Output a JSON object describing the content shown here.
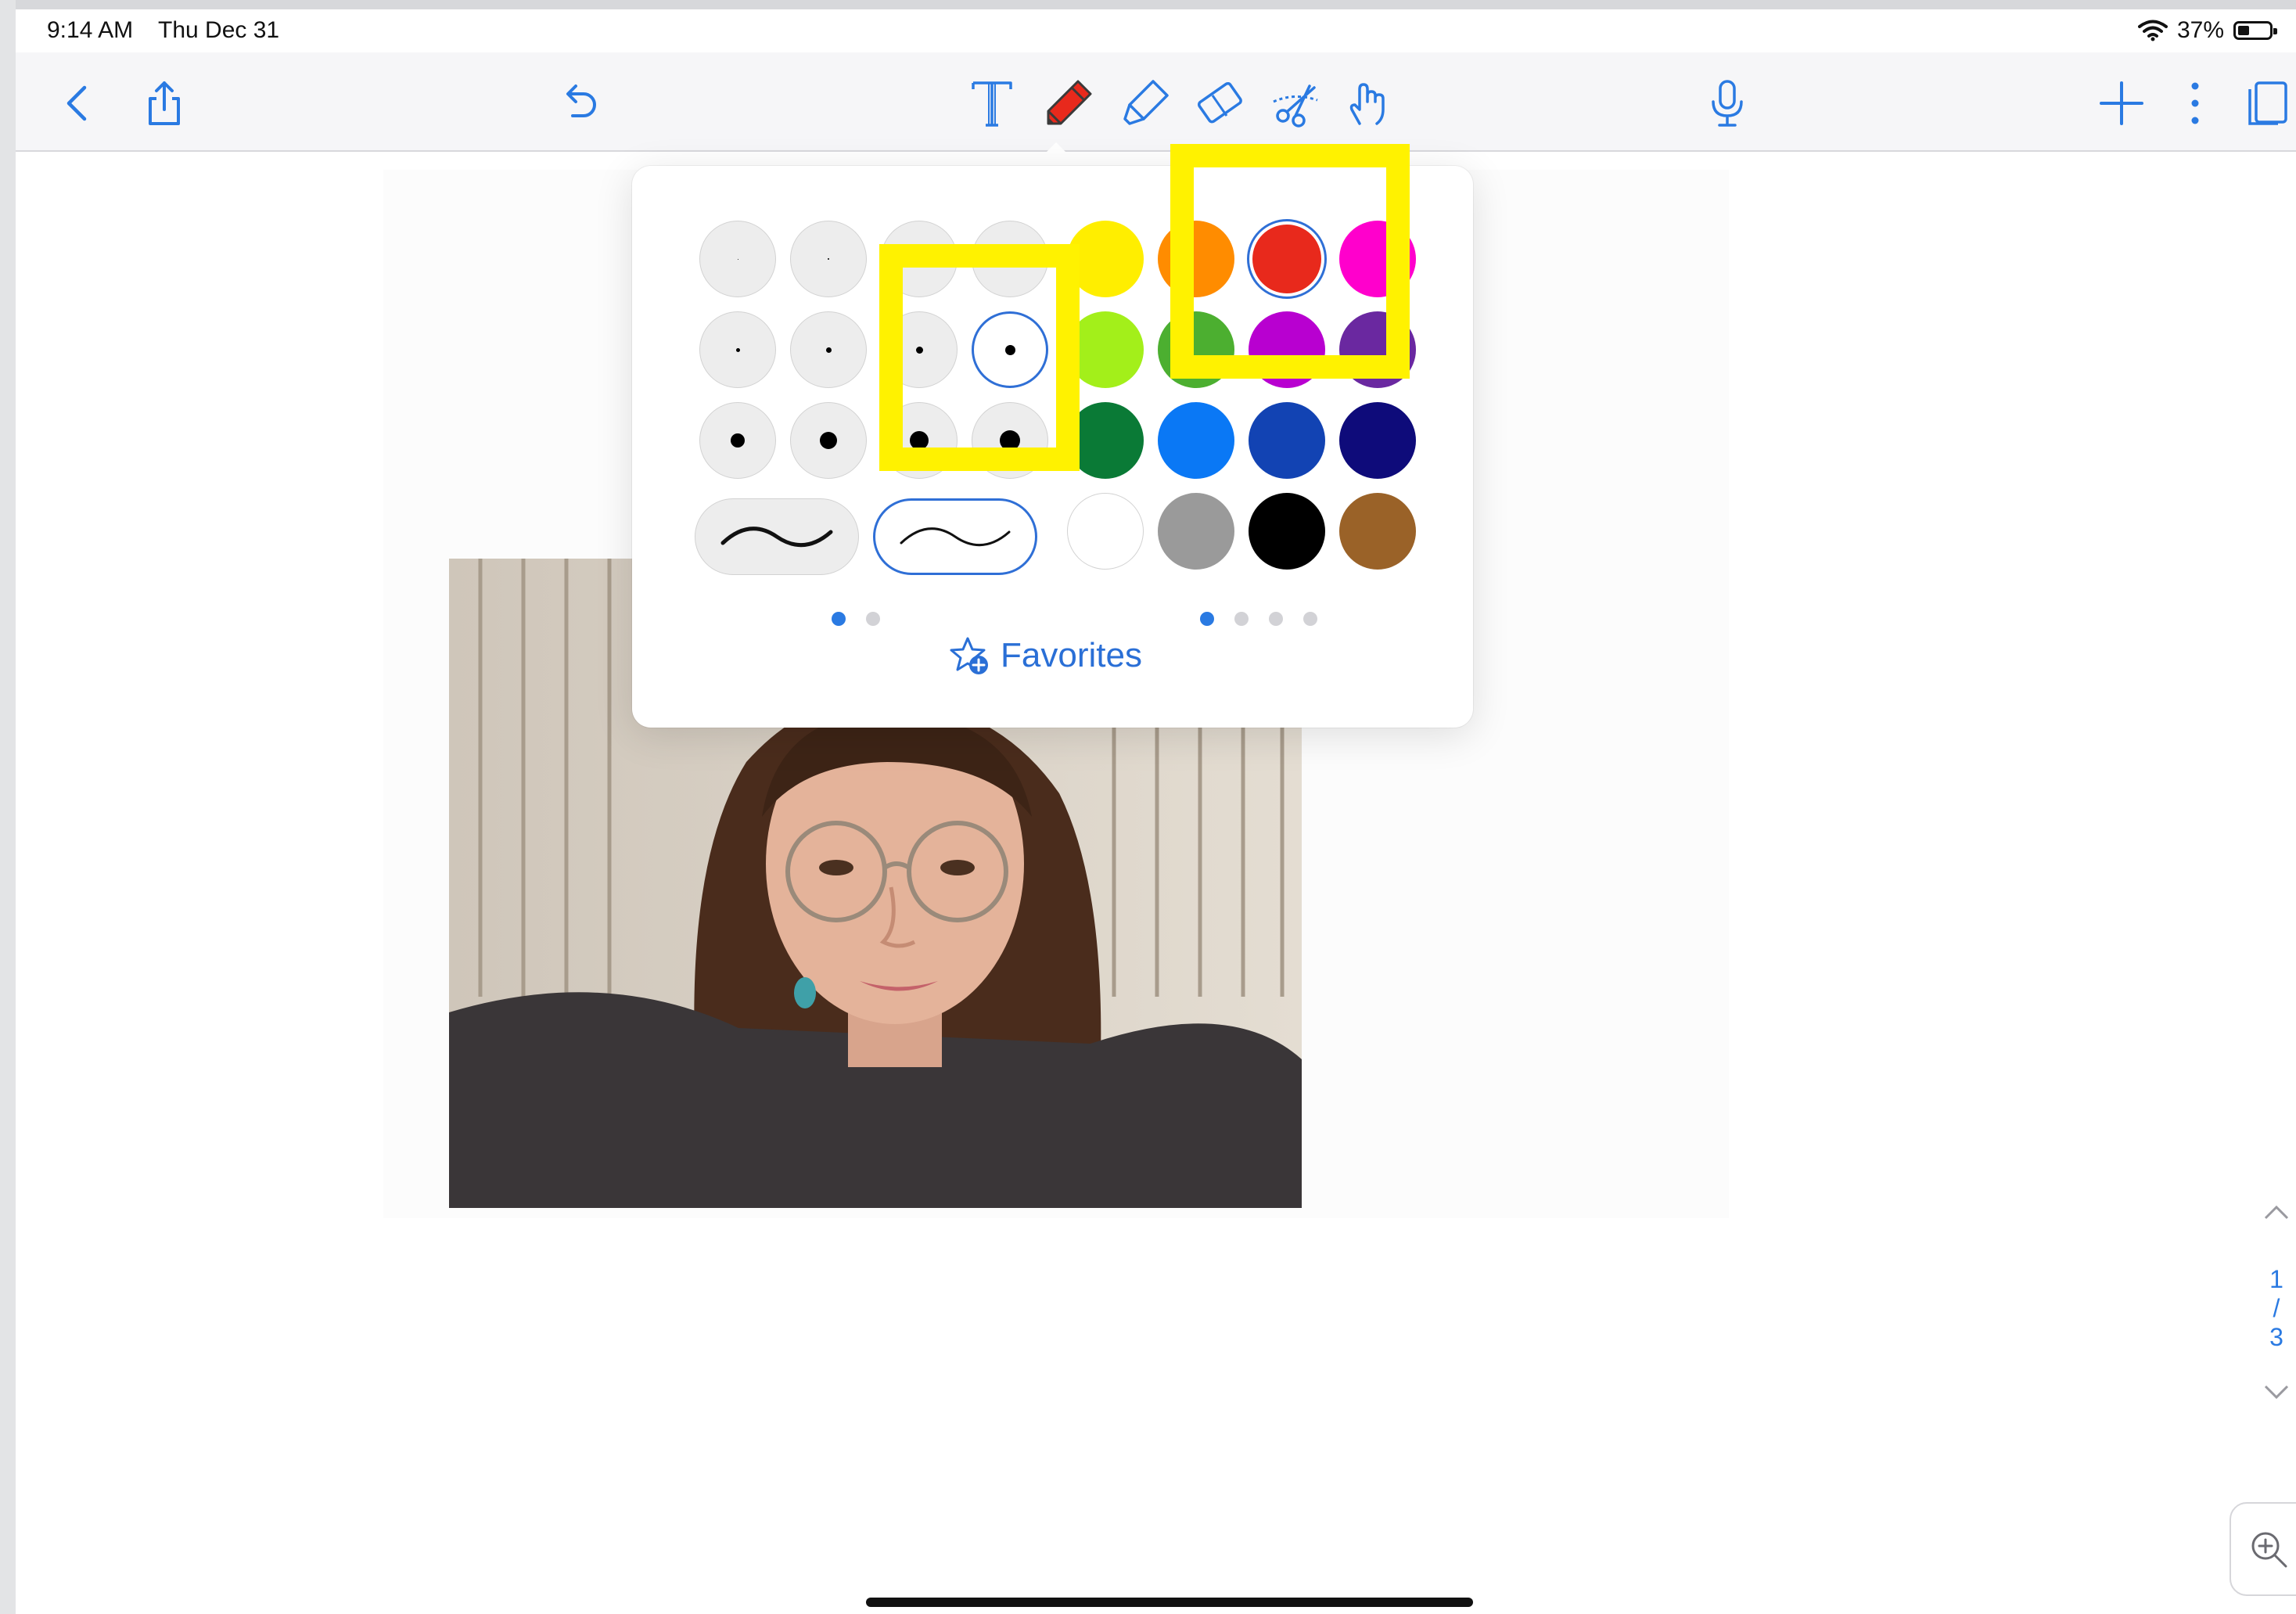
{
  "status_bar": {
    "time": "9:14 AM",
    "date": "Thu Dec 31",
    "battery": "37%",
    "battery_level": 0.37
  },
  "toolbar": {
    "left": [
      "back-icon",
      "share-icon",
      "undo-icon"
    ],
    "tools": [
      "text-tool-icon",
      "pen-tool-icon",
      "highlighter-tool-icon",
      "eraser-tool-icon",
      "lasso-scissors-icon",
      "hand-pointer-icon"
    ],
    "center": "microphone-icon",
    "right": [
      "add-icon",
      "more-icon",
      "pages-icon"
    ],
    "accent": "#2a7ae2",
    "pen_color": "#e8291c"
  },
  "pen_popover": {
    "size_grid": [
      [
        1,
        2,
        3,
        4
      ],
      [
        5,
        7,
        9,
        13
      ],
      [
        18,
        22,
        24,
        26
      ]
    ],
    "selected_size_index": [
      1,
      3
    ],
    "stroke_styles": [
      "smooth",
      "thin"
    ],
    "selected_stroke": 1,
    "colors": [
      [
        "#ffee00",
        "#ff8c00",
        "#e8291c",
        "#ff00cc"
      ],
      [
        "#a3ef1a",
        "#4caf30",
        "#b800d0",
        "#6a28a0"
      ],
      [
        "#0a7a36",
        "#0a78f5",
        "#1243b3",
        "#0e0b7a"
      ],
      [
        "#ffffff",
        "#9a9a9a",
        "#000000",
        "#9a6228"
      ]
    ],
    "selected_color": "#e8291c",
    "size_pages": 2,
    "size_page_active": 0,
    "color_pages": 4,
    "color_page_active": 0,
    "favorites_label": "Favorites"
  },
  "page_scroller": {
    "current": "1",
    "separator": "/",
    "total": "3"
  }
}
